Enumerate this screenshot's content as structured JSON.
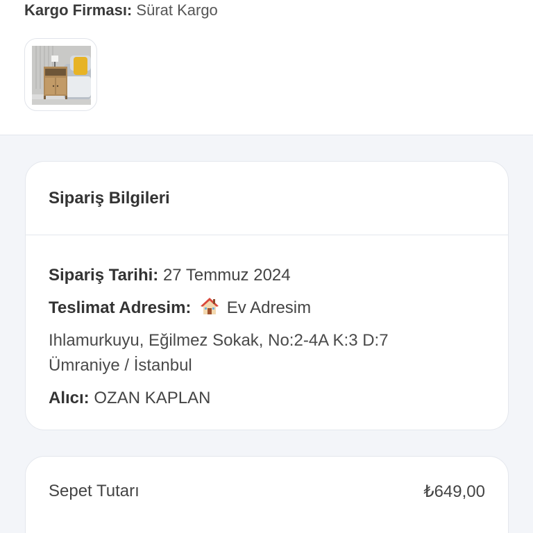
{
  "shipment": {
    "cargo_label": "Kargo Firması:",
    "cargo_value": "Sürat Kargo"
  },
  "order_info": {
    "title": "Sipariş Bilgileri",
    "date_label": "Sipariş Tarihi:",
    "date_value": "27 Temmuz 2024",
    "address_label": "Teslimat Adresim:",
    "address_icon": "house-icon",
    "address_name": "Ev Adresim",
    "address_line1": "Ihlamurkuyu, Eğilmez Sokak, No:2-4A K:3 D:7",
    "address_line2": "Ümraniye / İstanbul",
    "recipient_label": "Alıcı:",
    "recipient_value": "OZAN KAPLAN"
  },
  "summary": {
    "basket_label": "Sepet Tutarı",
    "basket_value": "₺649,00"
  }
}
